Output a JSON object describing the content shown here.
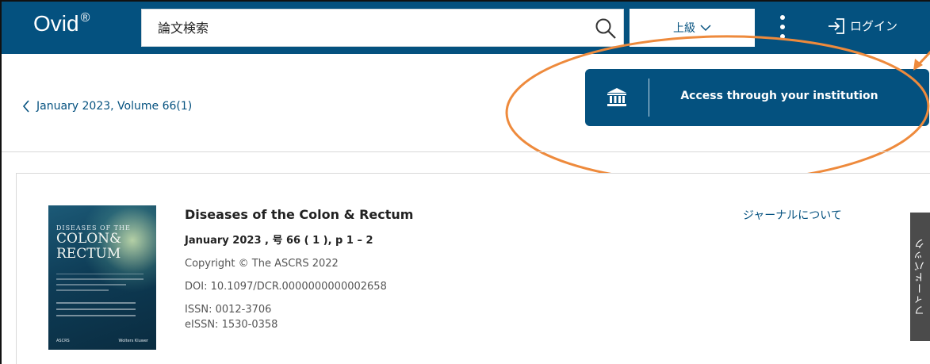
{
  "header": {
    "logo_text": "Ovid",
    "logo_mark": "®",
    "search_placeholder": "論文検索",
    "search_icon": "search-icon",
    "advanced_label": "上級",
    "more_icon": "kebab-menu-icon",
    "login_label": "ログイン",
    "login_icon": "sign-in-icon"
  },
  "subheader": {
    "back_label": "January 2023, Volume 66(1)",
    "access_button_label": "Access through your institution",
    "access_icon": "institution-icon"
  },
  "article": {
    "journal_title": "Diseases of the Colon & Rectum",
    "issue_line": "January 2023 , 号 66 ( 1 ), p 1 – 2",
    "copyright": "Copyright © The ASCRS 2022",
    "doi": "DOI: 10.1097/DCR.0000000000002658",
    "issn": "ISSN: 0012-3706",
    "eissn": "eISSN: 1530-0358",
    "journal_link": "ジャーナルについて",
    "cover": {
      "line1": "DISEASES OF THE",
      "line2": "COLON&",
      "line3": "RECTUM",
      "publisher_left": "ASCRS",
      "publisher_right": "Wolters Kluwer"
    }
  },
  "feedback_tab": "フィードバック",
  "colors": {
    "brand": "#04517f",
    "highlight": "#ee8a3c",
    "feedback_bg": "#4b4b4b"
  }
}
